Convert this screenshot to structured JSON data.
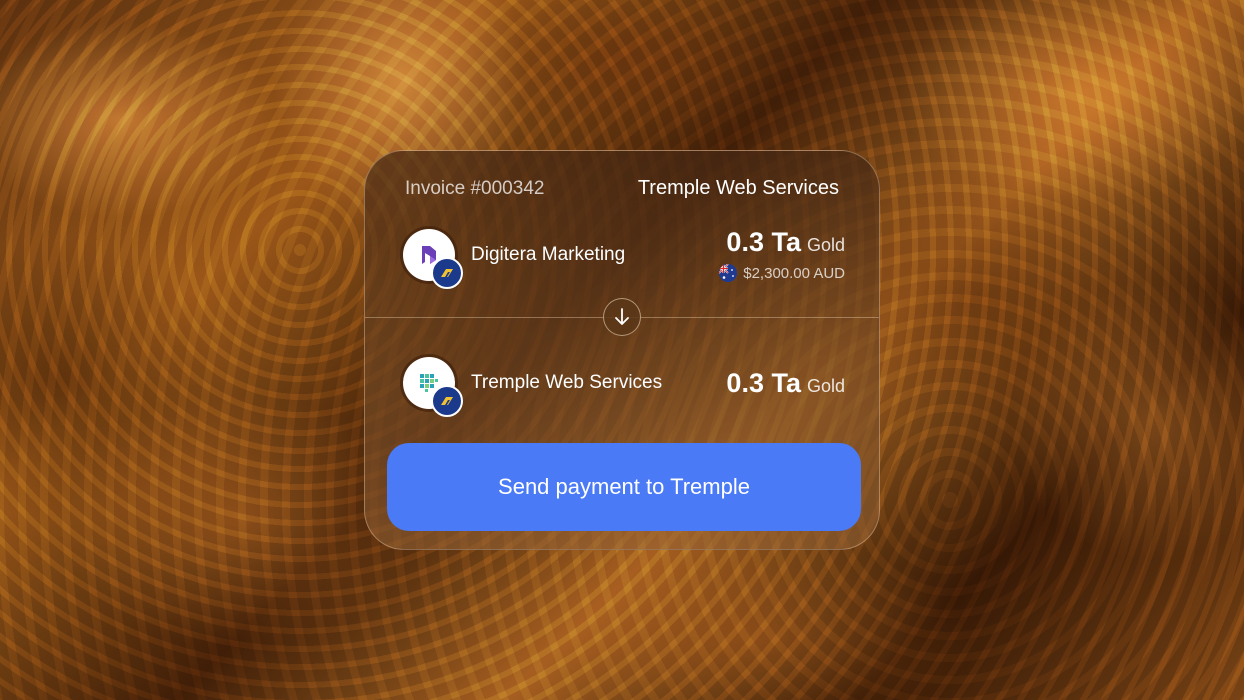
{
  "invoice": {
    "number": "Invoice #000342",
    "merchant": "Tremple Web Services"
  },
  "payer": {
    "name": "Digitera Marketing",
    "amount": "0.3 Ta",
    "unit": "Gold",
    "fiat": "$2,300.00 AUD",
    "logo_icon": "digitera-logo-icon",
    "badge_icon": "network-badge-icon"
  },
  "payee": {
    "name": "Tremple Web Services",
    "amount": "0.3 Ta",
    "unit": "Gold",
    "logo_icon": "tremple-logo-icon",
    "badge_icon": "network-badge-icon"
  },
  "action": {
    "label": "Send payment to Tremple",
    "color": "#4a7af5"
  },
  "direction_icon": "arrow-down-icon"
}
